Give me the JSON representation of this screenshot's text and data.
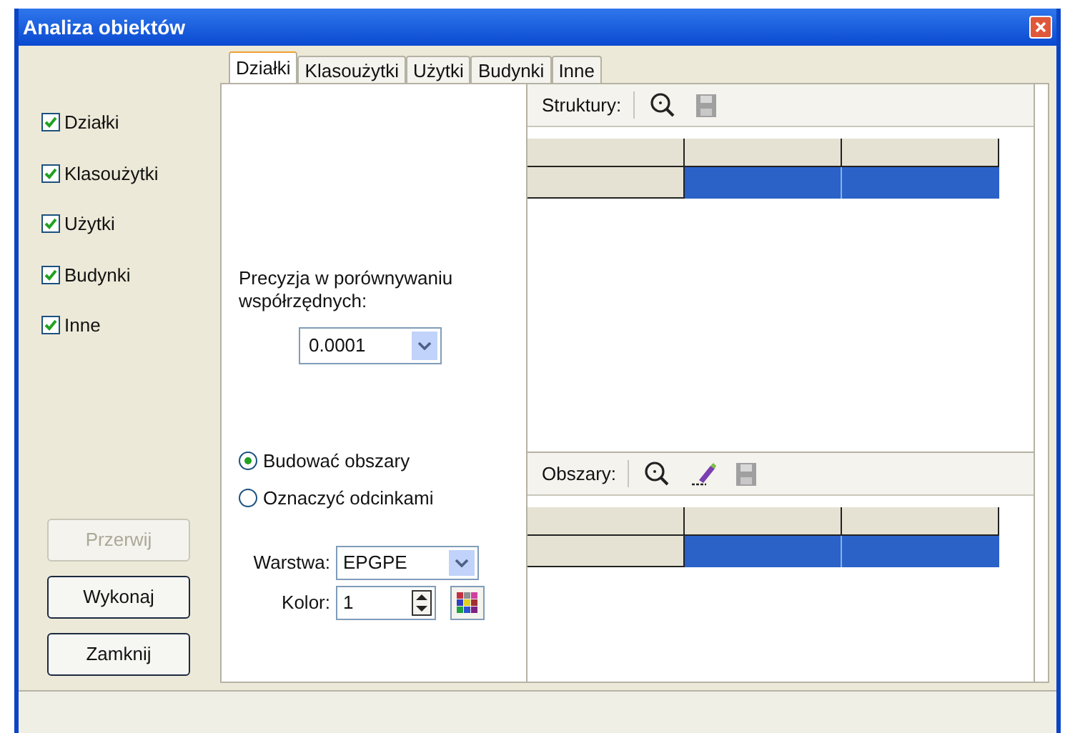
{
  "window": {
    "title": "Analiza obiektów"
  },
  "layers": [
    {
      "label": "Działki",
      "checked": true
    },
    {
      "label": "Klasoużytki",
      "checked": true
    },
    {
      "label": "Użytki",
      "checked": true
    },
    {
      "label": "Budynki",
      "checked": true
    },
    {
      "label": "Inne",
      "checked": true
    }
  ],
  "buttons": [
    {
      "label": "Przerwij",
      "disabled": true
    },
    {
      "label": "Wykonaj",
      "disabled": false
    },
    {
      "label": "Zamknij",
      "disabled": false
    }
  ],
  "tabs": [
    {
      "label": "Działki",
      "selected": true
    },
    {
      "label": "Klasoużytki",
      "selected": false
    },
    {
      "label": "Użytki",
      "selected": false
    },
    {
      "label": "Budynki",
      "selected": false
    },
    {
      "label": "Inne",
      "selected": false
    }
  ],
  "precision": {
    "label": "Precyzja w porównywaniu współrzędnych:",
    "value": "0.0001"
  },
  "mode": [
    {
      "label": "Budować obszary",
      "selected": true
    },
    {
      "label": "Oznaczyć odcinkami",
      "selected": false
    }
  ],
  "layer_field": {
    "label": "Warstwa:",
    "value": "EPGPE"
  },
  "color_field": {
    "label": "Kolor:",
    "value": "1"
  },
  "grids": [
    {
      "label": "Struktury:",
      "tools": [
        {
          "kind": "zoom",
          "disabled": false
        },
        {
          "kind": "save",
          "disabled": true
        }
      ],
      "rows": [
        {
          "selected": true
        }
      ]
    },
    {
      "label": "Obszary:",
      "tools": [
        {
          "kind": "zoom",
          "disabled": false
        },
        {
          "kind": "edit",
          "disabled": false
        },
        {
          "kind": "save",
          "disabled": true
        }
      ],
      "rows": [
        {
          "selected": true
        }
      ]
    }
  ]
}
